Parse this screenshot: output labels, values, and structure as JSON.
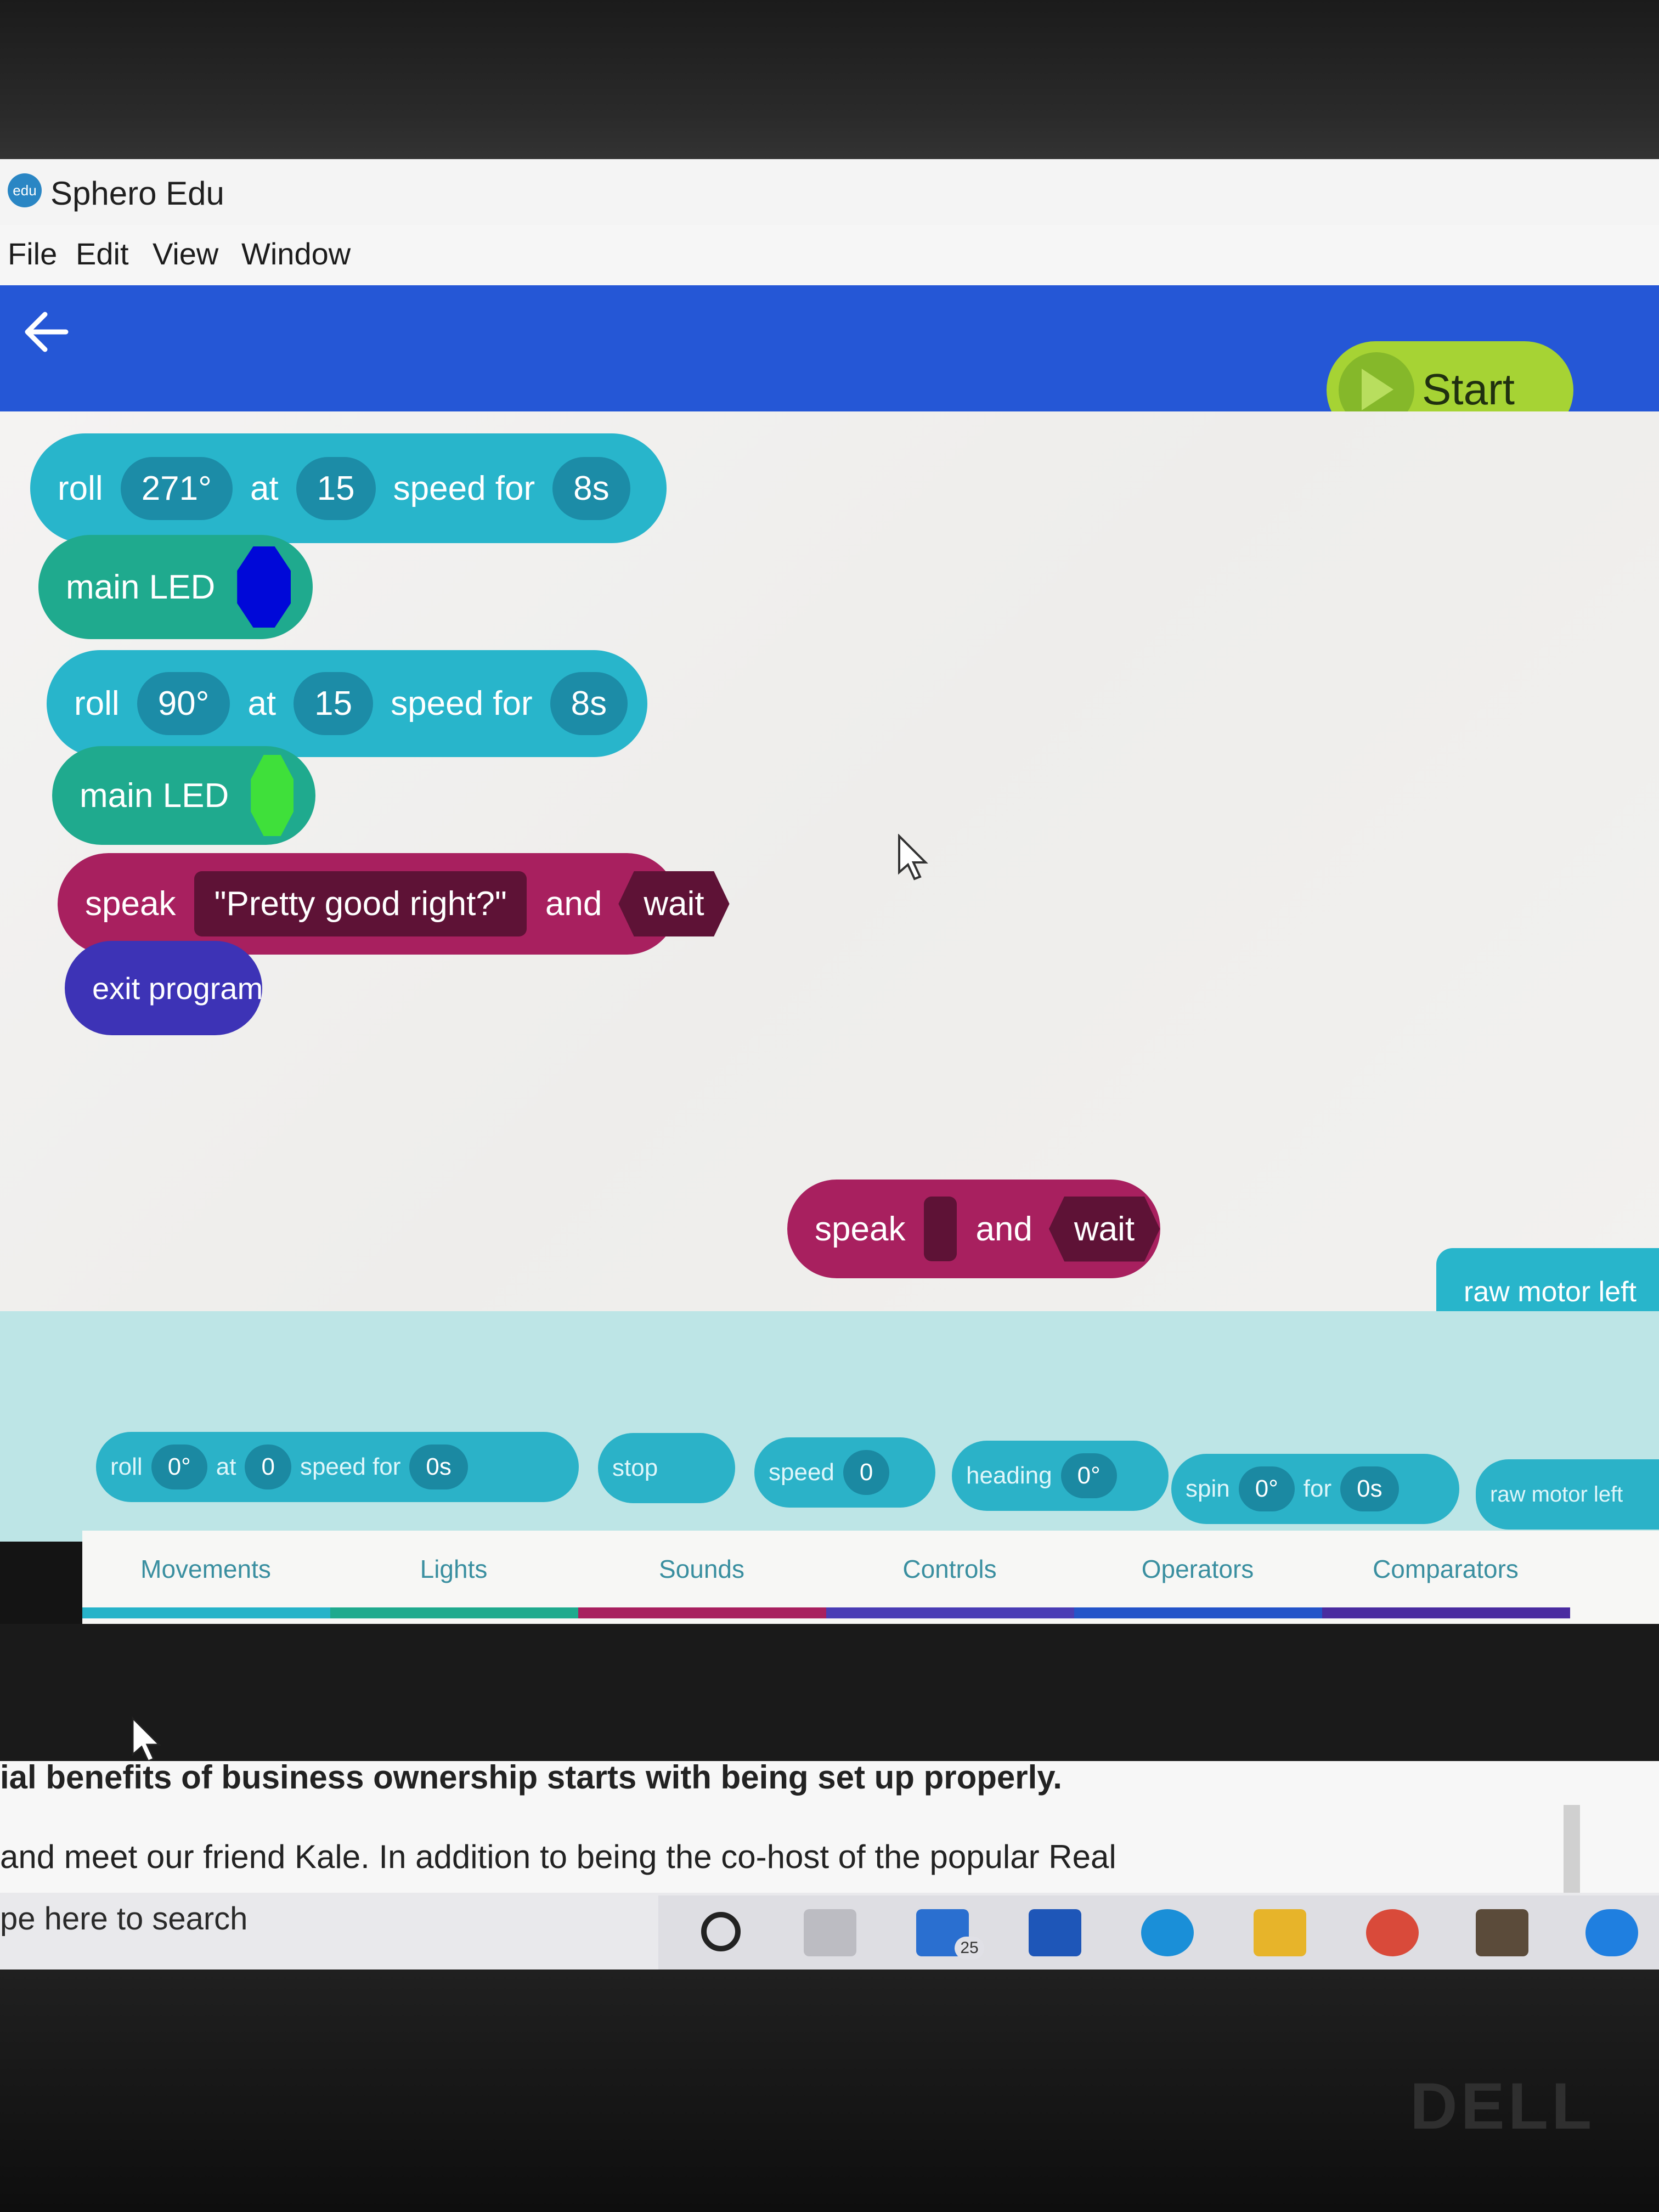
{
  "app": {
    "title": "Sphero Edu",
    "icon": "edu"
  },
  "menu": [
    "File",
    "Edit",
    "View",
    "Window"
  ],
  "header": {
    "start_label": "Start"
  },
  "program": {
    "roll1": {
      "label": "roll",
      "heading": "271°",
      "at": "at",
      "speed": "15",
      "speed_for": "speed for",
      "duration": "8s"
    },
    "led1": {
      "label": "main LED",
      "color": "#0008d8"
    },
    "roll2": {
      "label": "roll",
      "heading": "90°",
      "at": "at",
      "speed": "15",
      "speed_for": "speed for",
      "duration": "8s"
    },
    "led2": {
      "label": "main LED",
      "color": "#3fe03a"
    },
    "speak": {
      "label": "speak",
      "text": "\"Pretty good right?\"",
      "and": "and",
      "wait": "wait"
    },
    "exit": {
      "label": "exit program"
    }
  },
  "floating": {
    "speak": {
      "label": "speak",
      "and": "and",
      "wait": "wait"
    },
    "raw_motor": {
      "label": "raw motor left"
    }
  },
  "palette": {
    "roll": {
      "label": "roll",
      "heading": "0°",
      "at": "at",
      "speed": "0",
      "speed_for": "speed for",
      "duration": "0s"
    },
    "stop": {
      "label": "stop"
    },
    "speed": {
      "label": "speed",
      "value": "0"
    },
    "heading": {
      "label": "heading",
      "value": "0°"
    },
    "spin": {
      "label": "spin",
      "degrees": "0°",
      "for": "for",
      "duration": "0s"
    },
    "raw_motor": {
      "label": "raw motor left"
    }
  },
  "tabs": [
    {
      "label": "Movements",
      "color": "#26b3c9"
    },
    {
      "label": "Lights",
      "color": "#1faa8e"
    },
    {
      "label": "Sounds",
      "color": "#a8205f"
    },
    {
      "label": "Controls",
      "color": "#4a3db5"
    },
    {
      "label": "Operators",
      "color": "#2454c9"
    },
    {
      "label": "Comparators",
      "color": "#4a2ca0"
    }
  ],
  "background": {
    "doc_line1": "ial benefits of business ownership starts with being set up properly.",
    "doc_line2": "and meet our friend Kale.  In addition to being the co-host of the popular Real",
    "search": "pe here to search",
    "mail_badge": "25",
    "brand": "DELL"
  }
}
